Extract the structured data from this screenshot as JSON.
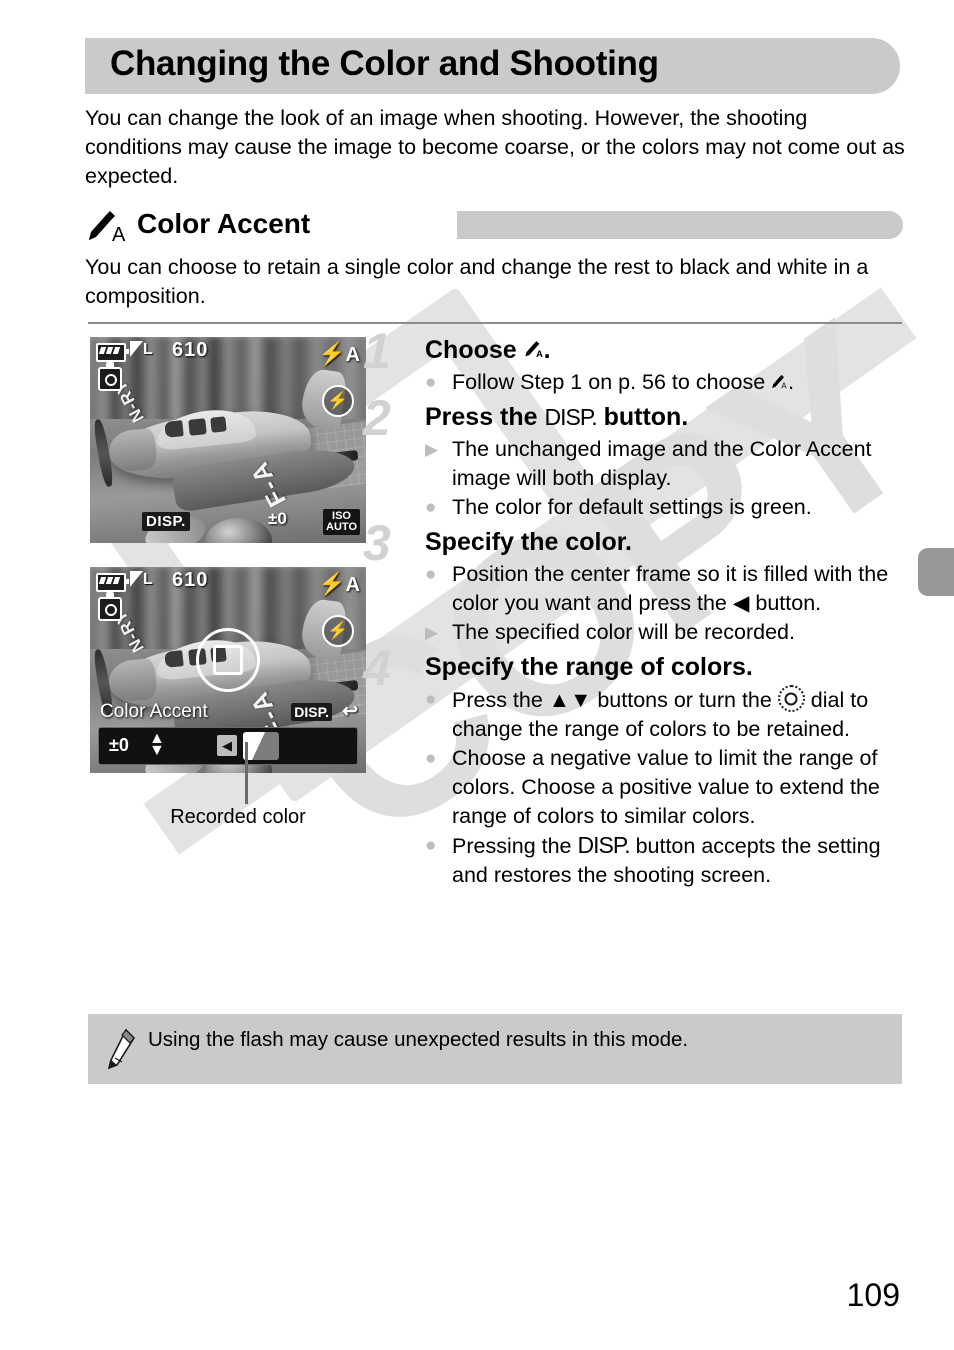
{
  "header": {
    "title": "Changing the Color and Shooting"
  },
  "intro": {
    "text": "You can change the look of an image when shooting. However, the shooting conditions may cause the image to become coarse, or the colors may not come out as expected."
  },
  "section": {
    "icon": "color-accent-brush-icon",
    "title": "Color Accent",
    "body": "You can choose to retain a single color and change the rest to black and white in a composition."
  },
  "screens": [
    {
      "name": "shooting-screen-normal",
      "osd": {
        "battery": "battery-icon",
        "quality": "L",
        "shots_remaining": "610",
        "camera_icon": "camera-icon",
        "flash_auto": "A",
        "flash_off": "flash-off-icon",
        "disp": "DISP.",
        "exposure": "±0",
        "iso_line1": "ISO",
        "iso_line2": "AUTO"
      }
    },
    {
      "name": "color-accent-screen",
      "osd": {
        "battery": "battery-icon",
        "quality": "L",
        "shots_remaining": "610",
        "camera_icon": "camera-icon",
        "flash_auto": "A",
        "flash_off": "flash-off-icon",
        "mode_label": "Color Accent",
        "disp": "DISP.",
        "return_arrow": "↩",
        "value": "±0",
        "left_button": "◀",
        "swatch": "recorded-color-swatch"
      }
    }
  ],
  "callout": {
    "label": "Recorded color"
  },
  "steps": [
    {
      "number": "1",
      "title_pre": "Choose ",
      "title_icon": "brush-a-icon",
      "title_post": ".",
      "bullets": [
        {
          "marker": "circle",
          "pre": "Follow Step 1 on p. 56 to choose ",
          "icon": "brush-a-icon",
          "post": "."
        }
      ]
    },
    {
      "number": "2",
      "title_pre": "Press the ",
      "title_icon": "DISP.",
      "title_post": " button.",
      "bullets": [
        {
          "marker": "triangle",
          "text": "The unchanged image and the Color Accent image will both display."
        },
        {
          "marker": "circle",
          "text": "The color for default settings is green."
        }
      ]
    },
    {
      "number": "3",
      "title": "Specify the color.",
      "bullets": [
        {
          "marker": "circle",
          "pre": "Position the center frame so it is filled with the color you want and press the ",
          "icon": "◀",
          "post": " button."
        },
        {
          "marker": "triangle",
          "text": "The specified color will be recorded."
        }
      ]
    },
    {
      "number": "4",
      "title": "Specify the range of colors.",
      "bullets": [
        {
          "marker": "circle",
          "pre": "Press the ",
          "icon": "▲▼",
          "mid": " buttons or turn the ",
          "icon2": "control-dial-icon",
          "post": " dial to change the range of colors to be retained."
        },
        {
          "marker": "circle",
          "text": "Choose a negative value to limit the range of colors. Choose a positive value to extend the range of colors to similar colors."
        },
        {
          "marker": "circle",
          "pre": "Pressing the ",
          "icon": "DISP.",
          "post": " button accepts the setting and restores the shooting screen."
        }
      ]
    }
  ],
  "note": {
    "icon": "pencil-icon",
    "text": "Using the flash may cause unexpected results in this mode."
  },
  "watermark": {
    "text": "COPY"
  },
  "page_number": "109",
  "colors": {
    "banner_gray": "#cacaca",
    "step_number_gray": "#d2d2d2",
    "bullet_gray": "#bdbdbd",
    "watermark_gray": "#dedede",
    "tab_gray": "#989898",
    "divider_gray": "#8c8c8c"
  }
}
